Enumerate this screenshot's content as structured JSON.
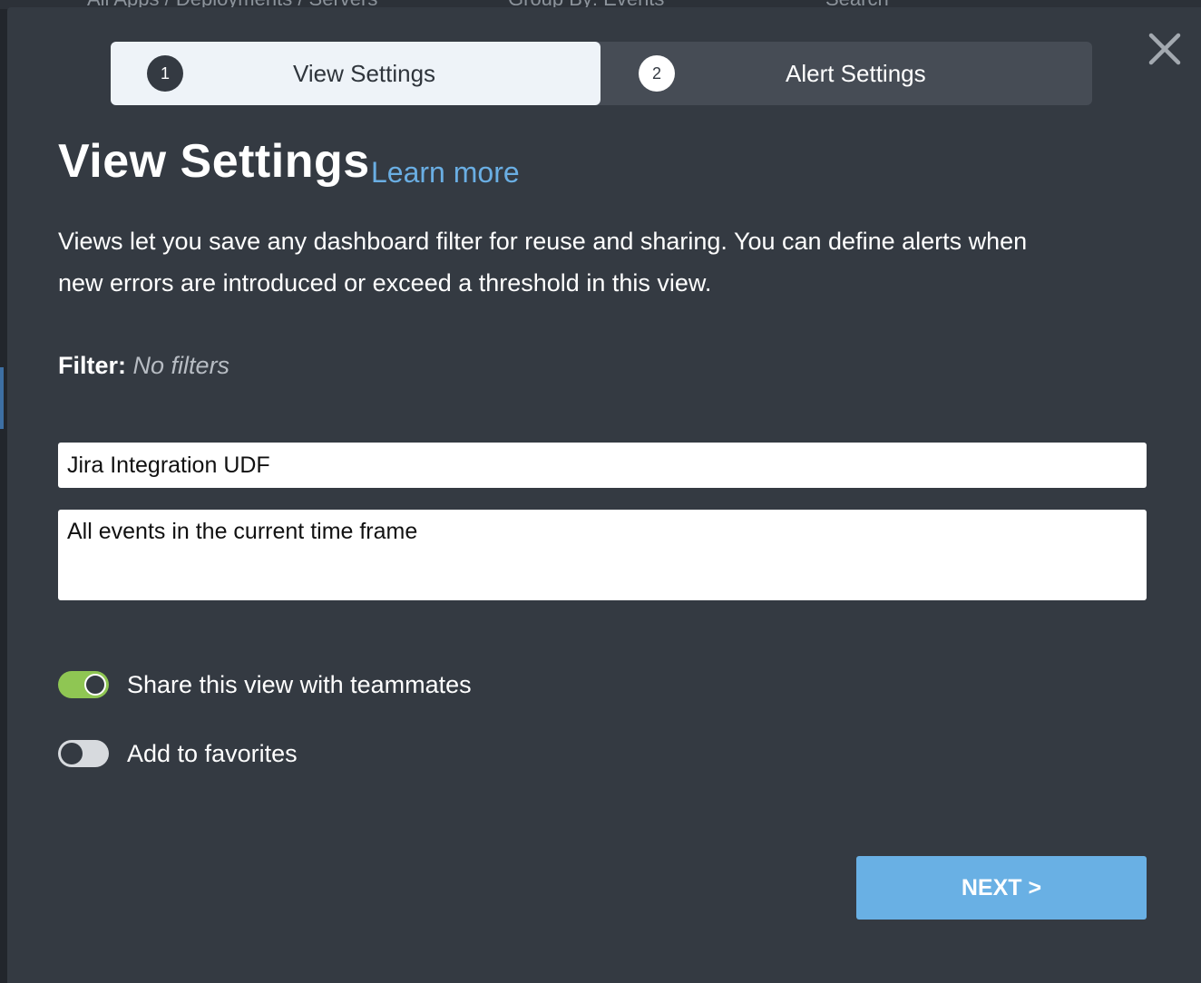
{
  "background": {
    "breadcrumb": "All Apps / Deployments / Servers",
    "group_by": "Group By: Events",
    "search": "Search"
  },
  "stepper": {
    "steps": [
      {
        "number": "1",
        "label": "View Settings",
        "active": true
      },
      {
        "number": "2",
        "label": "Alert Settings",
        "active": false
      }
    ]
  },
  "header": {
    "title": "View Settings",
    "learn_more": "Learn more"
  },
  "description": "Views let you save any dashboard filter for reuse and sharing. You can define alerts when new errors are introduced or exceed a threshold in this view.",
  "filter": {
    "label": "Filter:",
    "value": "No filters"
  },
  "form": {
    "name_value": "Jira Integration UDF",
    "description_value": "All events in the current time frame"
  },
  "toggles": {
    "share": {
      "label": "Share this view with teammates",
      "checked": true
    },
    "favorites": {
      "label": "Add to favorites",
      "checked": false
    }
  },
  "footer": {
    "next_label": "NEXT >"
  },
  "colors": {
    "modal_bg": "#343a42",
    "accent_blue": "#69b0e4",
    "toggle_on": "#8fc653",
    "active_step_bg": "#eef3f8"
  },
  "icons": {
    "close": "close-icon"
  }
}
